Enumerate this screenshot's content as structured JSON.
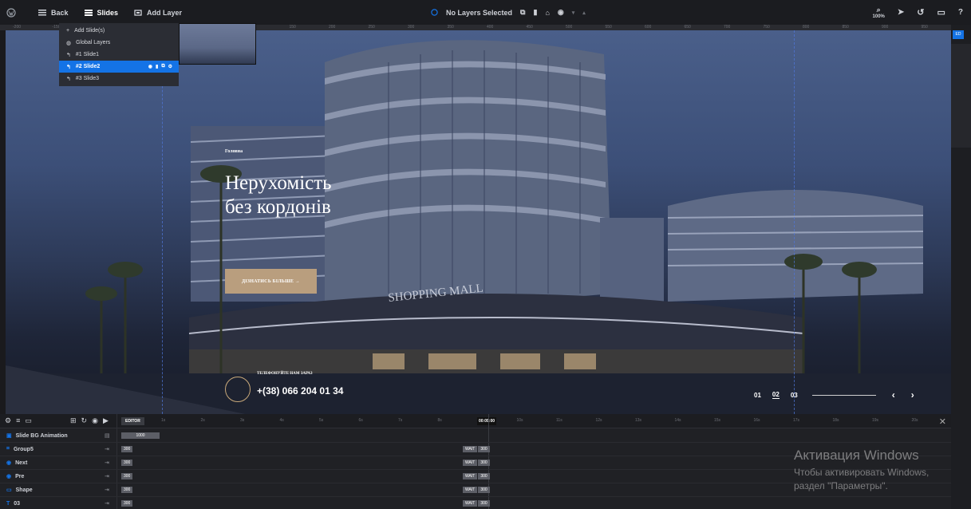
{
  "topbar": {
    "back_label": "Back",
    "slides_label": "Slides",
    "add_layer_label": "Add Layer",
    "no_layers_label": "No Layers Selected",
    "zoom_label": "100%"
  },
  "ruler": {
    "ticks": [
      "-400",
      "-350",
      "-300",
      "-250",
      "-200",
      "-150",
      "-100",
      "-50",
      "0",
      "50",
      "100",
      "150",
      "200",
      "250",
      "300",
      "350",
      "400",
      "450",
      "500",
      "550",
      "600",
      "650",
      "700",
      "750",
      "800",
      "850",
      "900",
      "950",
      "1000",
      "1050",
      "1100",
      "1150",
      "1200",
      "1250",
      "1300",
      "1350",
      "1400"
    ]
  },
  "slides_menu": {
    "items": [
      {
        "label": "Add Slide(s)",
        "icon": "plus-icon"
      },
      {
        "label": "Global Layers",
        "icon": "globe-icon"
      },
      {
        "label": "#1 Slide1",
        "icon": "drag-icon"
      },
      {
        "label": "#2 Slide2",
        "icon": "drag-icon",
        "active": true
      },
      {
        "label": "#3 Slide3",
        "icon": "drag-icon"
      }
    ]
  },
  "slide": {
    "tag": "Головна",
    "title": "Нерухомість\nбез кордонів",
    "cta": "ДІЗНАТИСЬ БІЛЬШЕ →",
    "phone_caption": "ТЕЛЕФОНУЙТЕ НАМ ЗАРАЗ",
    "phone_number": "+(38) 066 204 01 34",
    "pager": [
      "01",
      "02",
      "03"
    ],
    "prev_arrow": "‹",
    "next_arrow": "›",
    "building_sign": "SHOPPING MALL"
  },
  "right_panel": {
    "tab_label": "ED"
  },
  "timeline": {
    "editor_label": "EDITOR",
    "time_display": "00:09:00",
    "ticks": [
      "1s",
      "2s",
      "3s",
      "4s",
      "5s",
      "6s",
      "7s",
      "8s",
      "",
      "10s",
      "11s",
      "12s",
      "13s",
      "14s",
      "15s",
      "16s",
      "17s",
      "18s",
      "19s",
      "20s"
    ],
    "rows": [
      {
        "name": "Slide BG Animation",
        "bar": "1000",
        "wait": false,
        "icon": "bg-icon"
      },
      {
        "name": "Group5",
        "bar": "300",
        "wait": true,
        "wait_label": "WAIT",
        "wait_value": "300",
        "icon": "group-icon"
      },
      {
        "name": "Next",
        "bar": "300",
        "wait": true,
        "wait_label": "WAIT",
        "wait_value": "300",
        "icon": "button-icon"
      },
      {
        "name": "Pre",
        "bar": "300",
        "wait": true,
        "wait_label": "WAIT",
        "wait_value": "300",
        "icon": "button-icon"
      },
      {
        "name": "Shape",
        "bar": "300",
        "wait": true,
        "wait_label": "WAIT",
        "wait_value": "300",
        "icon": "shape-icon"
      },
      {
        "name": "03",
        "bar": "300",
        "wait": true,
        "wait_label": "WAIT",
        "wait_value": "300",
        "icon": "text-icon"
      }
    ]
  },
  "watermark": {
    "title": "Активация Windows",
    "line1": "Чтобы активировать Windows,",
    "line2": "раздел \"Параметры\"."
  },
  "colors": {
    "accent": "#1473e6",
    "cta": "#b99e7e",
    "panel": "#1b1c20"
  }
}
